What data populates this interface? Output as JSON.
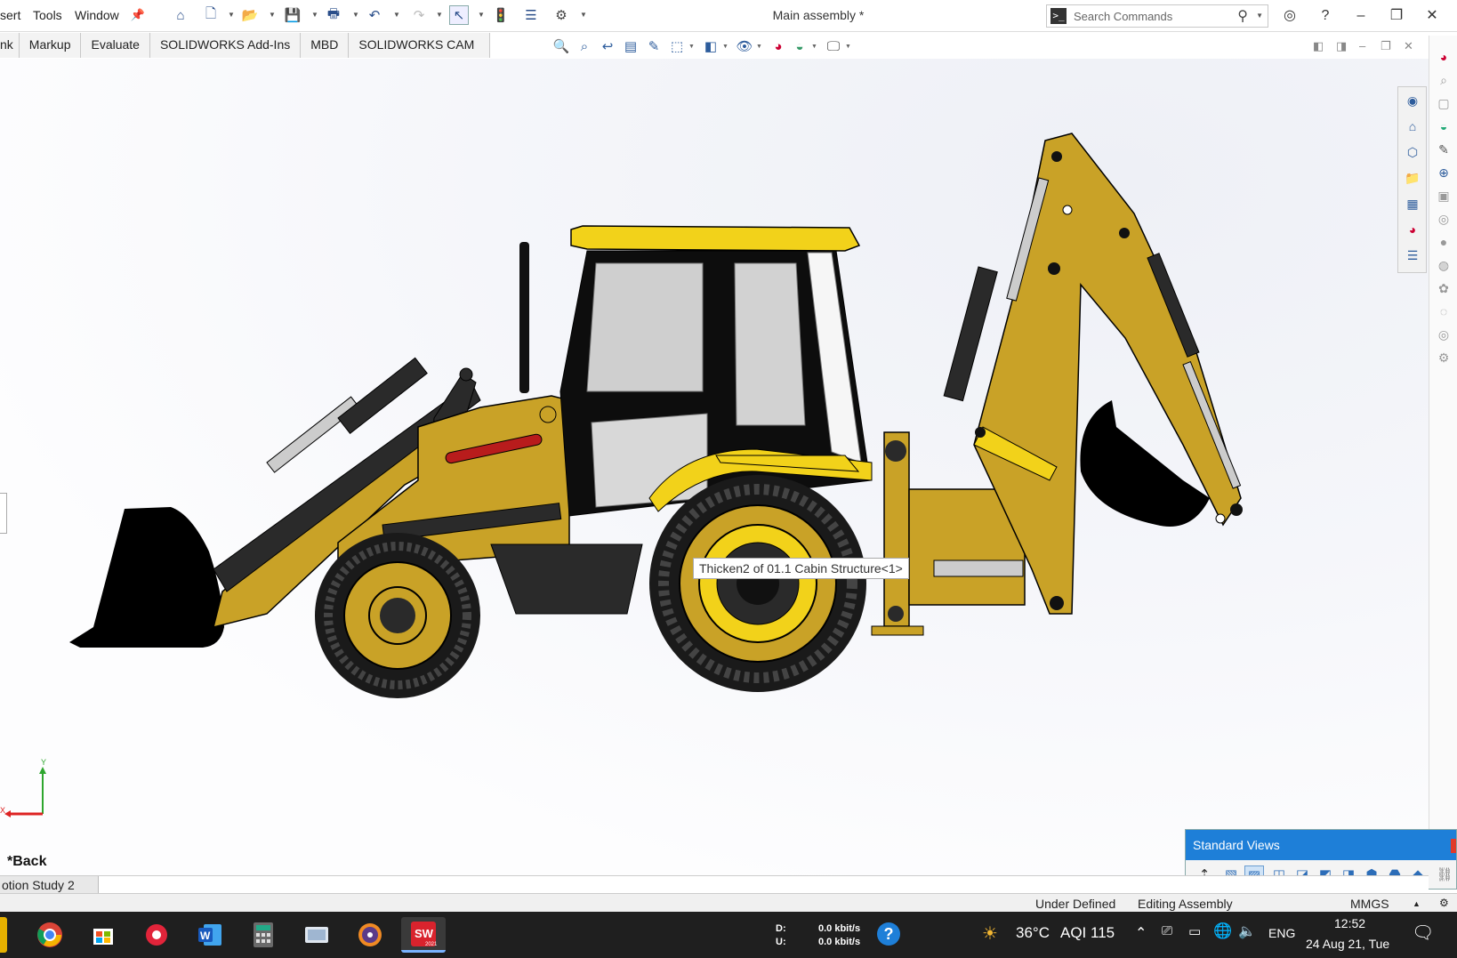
{
  "menu": {
    "items": [
      "sert",
      "Tools",
      "Window"
    ]
  },
  "document": {
    "title": "Main assembly *"
  },
  "search": {
    "placeholder": "Search Commands"
  },
  "tabs": [
    "nk",
    "Markup",
    "Evaluate",
    "SOLIDWORKS Add-Ins",
    "MBD",
    "SOLIDWORKS CAM"
  ],
  "graphics": {
    "tooltip": "Thicken2 of 01.1 Cabin Structure<1>",
    "view_name": "*Back",
    "triad": {
      "x_label": "X",
      "y_label": "Y"
    }
  },
  "standard_views": {
    "title": "Standard Views"
  },
  "study_tab": "otion Study 2",
  "status": {
    "definition": "Under Defined",
    "mode": "Editing Assembly",
    "units": "MMGS"
  },
  "taskbar": {
    "net_down_label": "D:",
    "net_up_label": "U:",
    "net_down": "0.0 kbit/s",
    "net_up": "0.0 kbit/s",
    "weather": "36°C",
    "aqi": "AQI 115",
    "language": "ENG",
    "time": "12:52",
    "date": "24 Aug 21, Tue",
    "sw_badge": "2021"
  },
  "colors": {
    "body_yellow": "#c9a227",
    "bright_yellow": "#f2d21a",
    "tire": "#1a1a1a",
    "accent_blue": "#1e7fd8"
  }
}
